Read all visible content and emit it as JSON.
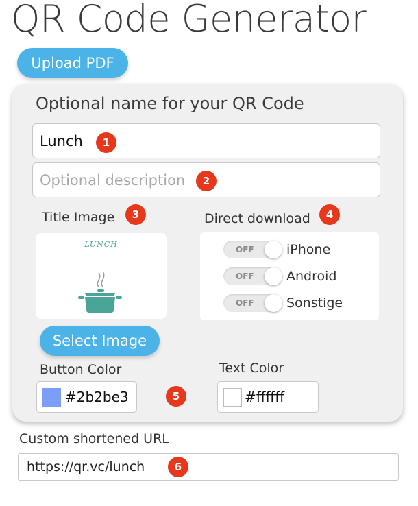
{
  "header": {
    "title": "QR Code Generator",
    "upload_label": "Upload PDF"
  },
  "form": {
    "heading": "Optional name for your QR Code",
    "name_value": "Lunch",
    "description_placeholder": "Optional description",
    "title_image_label": "Title Image",
    "image_caption": "LUNCH",
    "select_image_label": "Select Image",
    "direct_download_label": "Direct download",
    "toggles": [
      {
        "state": "OFF",
        "label": "iPhone"
      },
      {
        "state": "OFF",
        "label": "Android"
      },
      {
        "state": "OFF",
        "label": "Sonstige"
      }
    ],
    "button_color_label": "Button Color",
    "button_color_value": "#2b2be3",
    "text_color_label": "Text Color",
    "text_color_value": "#ffffff"
  },
  "url": {
    "label": "Custom shortened URL",
    "prefix": "https://qr.vc/",
    "slug": "lunch"
  },
  "badges": [
    "1",
    "2",
    "3",
    "4",
    "5",
    "6"
  ],
  "colors": {
    "accent": "#4bb3e8",
    "badge": "#e8381c",
    "button_swatch": "#7b9ff6",
    "text_swatch": "#ffffff",
    "icon": "#4aa598"
  }
}
